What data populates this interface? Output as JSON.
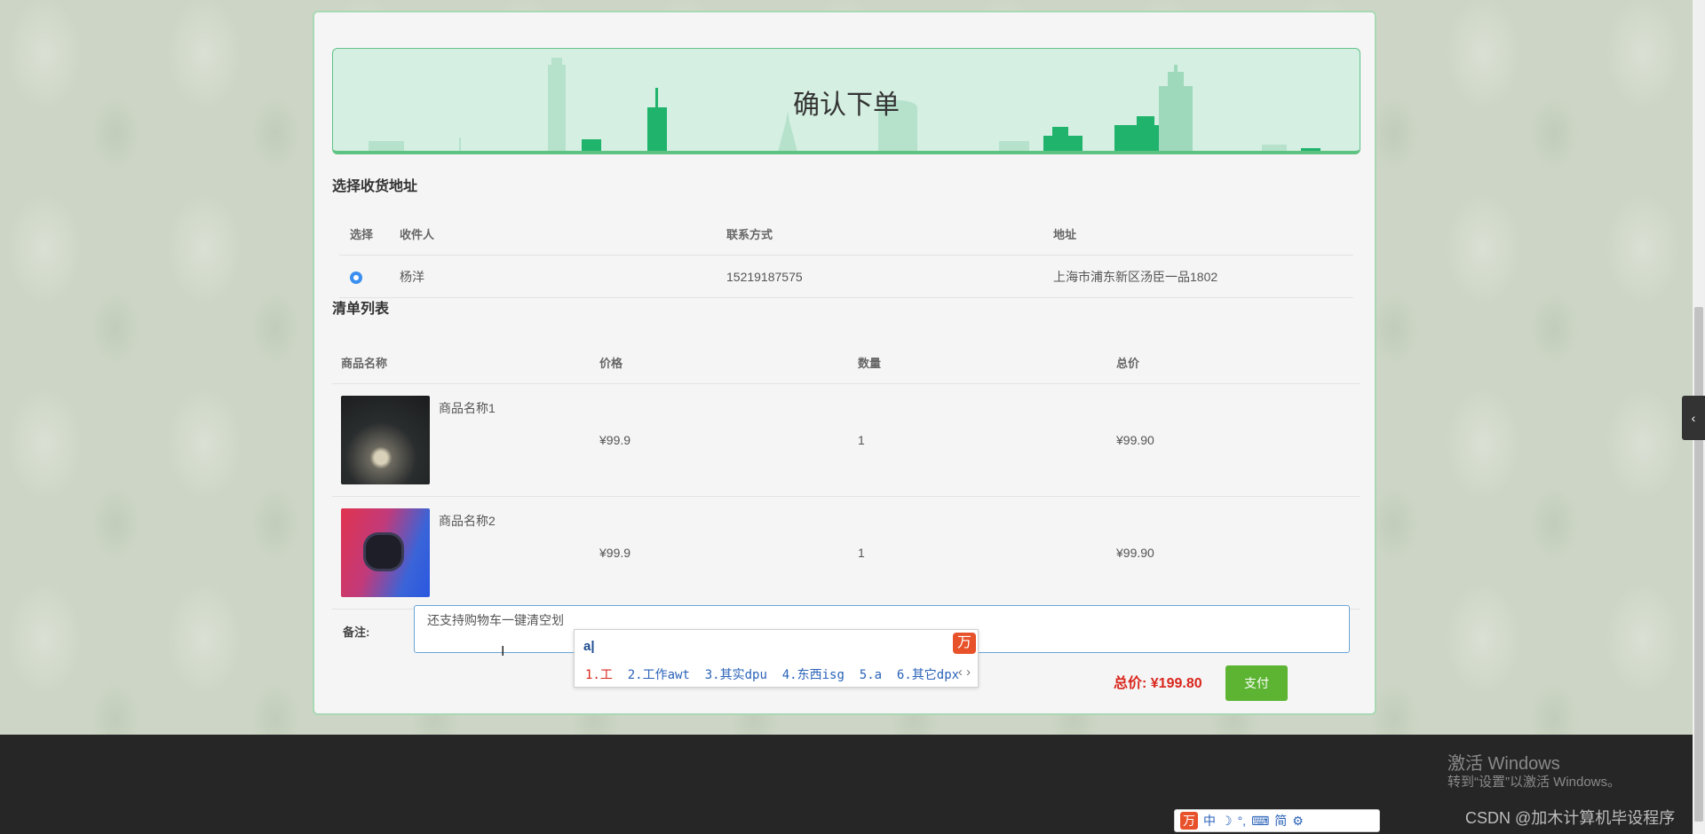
{
  "banner": {
    "title": "确认下单"
  },
  "address": {
    "section_title": "选择收货地址",
    "columns": [
      "选择",
      "收件人",
      "联系方式",
      "地址"
    ],
    "rows": [
      {
        "selected": true,
        "recipient": "杨洋",
        "phone": "15219187575",
        "address": "上海市浦东新区汤臣一品1802"
      }
    ]
  },
  "cart": {
    "section_title": "清单列表",
    "columns": [
      "商品名称",
      "价格",
      "数量",
      "总价"
    ],
    "items": [
      {
        "name": "商品名称1",
        "price": "¥99.9",
        "qty": "1",
        "total": "¥99.90",
        "image": "necklace-photo"
      },
      {
        "name": "商品名称2",
        "price": "¥99.9",
        "qty": "1",
        "total": "¥99.90",
        "image": "earbuds-photo"
      }
    ]
  },
  "remark": {
    "label": "备注:",
    "value": "还支持购物车一键清空划"
  },
  "summary": {
    "total_label": "总价:  ¥199.80",
    "pay_label": "支付"
  },
  "ime_popup": {
    "input": "a|",
    "candidates": [
      "1.工",
      "2.工作awt",
      "3.其实dpu",
      "4.东西isg",
      "5.a",
      "6.其它dpx"
    ],
    "logo_glyph": "万",
    "arrows": "‹ ›"
  },
  "footer": {
    "activate_title": "激活 Windows",
    "activate_sub": "转到“设置”以激活 Windows。",
    "watermark": "CSDN @加木计算机毕设程序"
  },
  "ime_toolbar": {
    "items": [
      "中",
      "☽",
      "°,",
      "⌨",
      "简",
      "⚙"
    ]
  },
  "side_tab": {
    "glyph": "‹"
  },
  "colors": {
    "accent_green": "#5cb432",
    "price_red": "#d9261c",
    "banner_bg": "#d5efe2"
  }
}
